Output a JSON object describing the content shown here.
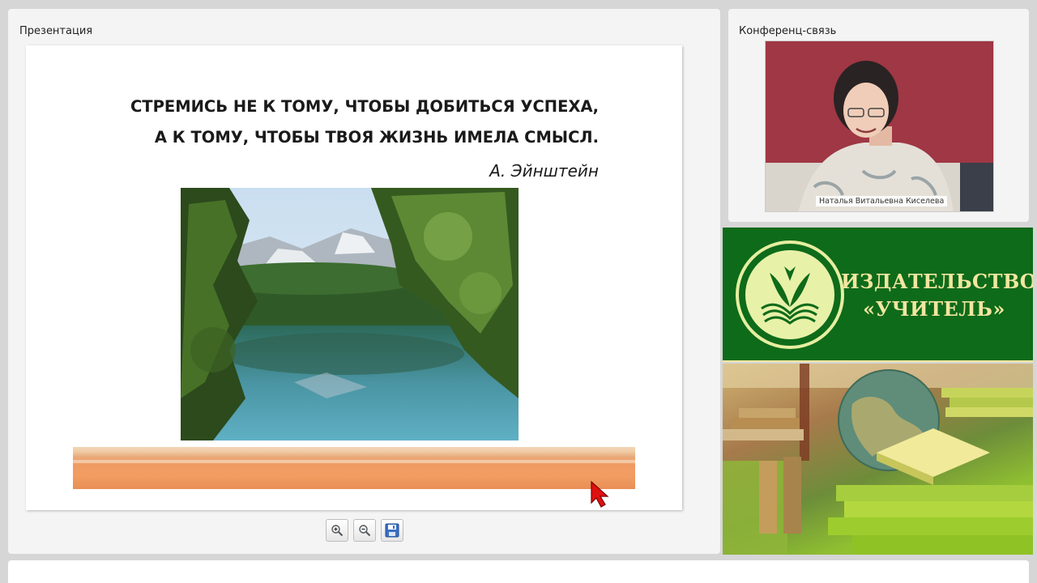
{
  "presentation": {
    "title": "Презентация",
    "slide": {
      "quote_line1": "СТРЕМИСЬ НЕ К ТОМУ, ЧТОБЫ ДОБИТЬСЯ УСПЕХА,",
      "quote_line2": "А К ТОМУ, ЧТОБЫ ТВОЯ ЖИЗНЬ ИМЕЛА СМЫСЛ.",
      "author": "А. Эйнштейн"
    },
    "toolbar": [
      "zoom-in-icon",
      "zoom-out-icon",
      "save-icon"
    ]
  },
  "conference": {
    "title": "Конференц-связь",
    "participant_name": "Наталья Витальевна Киселева"
  },
  "banner": {
    "line1": "ИЗДАТЕЛЬСТВО",
    "line2": "«УЧИТЕЛЬ»"
  },
  "colors": {
    "banner_green": "#0e6b1a",
    "banner_text": "#f1e6a0",
    "video_bg": "#9f3744",
    "cursor": "#e01010"
  }
}
